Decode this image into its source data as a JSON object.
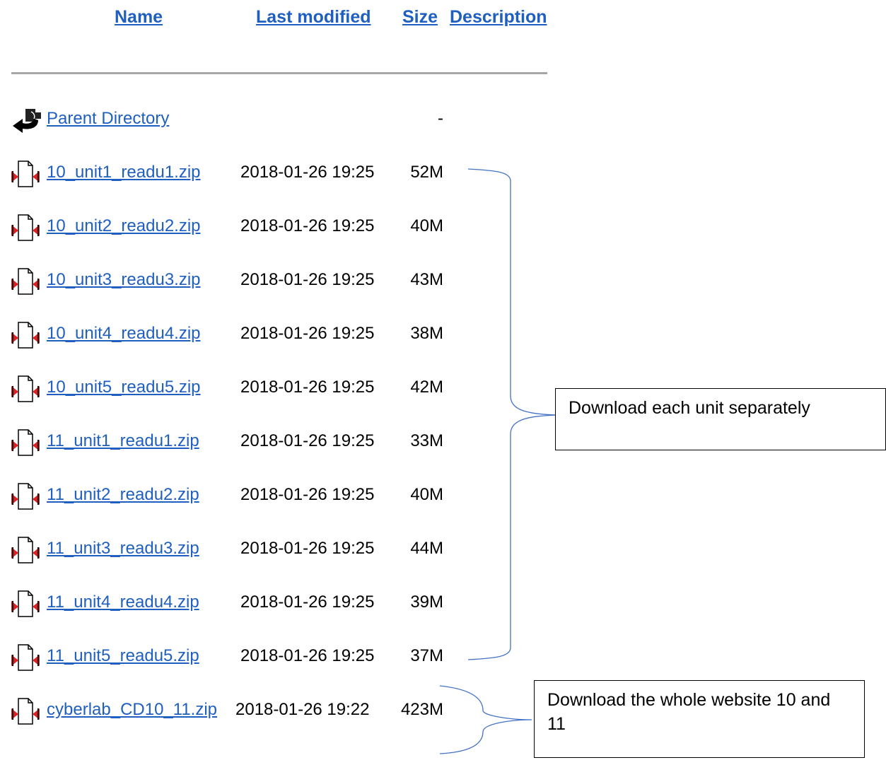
{
  "headers": {
    "name": "Name",
    "last_modified": "Last modified",
    "size": "Size",
    "description": "Description"
  },
  "parent": {
    "label": "Parent Directory",
    "size": "-",
    "icon": "back-arrow-icon"
  },
  "files": [
    {
      "name": "10_unit1_readu1.zip",
      "modified": "2018-01-26 19:25",
      "size": "52M"
    },
    {
      "name": "10_unit2_readu2.zip",
      "modified": "2018-01-26 19:25",
      "size": "40M"
    },
    {
      "name": "10_unit3_readu3.zip",
      "modified": "2018-01-26 19:25",
      "size": "43M"
    },
    {
      "name": "10_unit4_readu4.zip",
      "modified": "2018-01-26 19:25",
      "size": "38M"
    },
    {
      "name": "10_unit5_readu5.zip",
      "modified": "2018-01-26 19:25",
      "size": "42M"
    },
    {
      "name": "11_unit1_readu1.zip",
      "modified": "2018-01-26 19:25",
      "size": "33M"
    },
    {
      "name": "11_unit2_readu2.zip",
      "modified": "2018-01-26 19:25",
      "size": "40M"
    },
    {
      "name": "11_unit3_readu3.zip",
      "modified": "2018-01-26 19:25",
      "size": "44M"
    },
    {
      "name": "11_unit4_readu4.zip",
      "modified": "2018-01-26 19:25",
      "size": "39M"
    },
    {
      "name": "11_unit5_readu5.zip",
      "modified": "2018-01-26 19:25",
      "size": "37M"
    },
    {
      "name": "cyberlab_CD10_11.zip",
      "modified": "2018-01-26 19:22",
      "size": "423M"
    }
  ],
  "annotations": {
    "units": "Download each unit separately",
    "whole": "Download the whole website 10 and 11"
  },
  "colors": {
    "link": "#1f5fbf",
    "bracket": "#4472c4",
    "rule": "#a6a6a6"
  },
  "icons": {
    "file": "compressed-file-icon"
  }
}
